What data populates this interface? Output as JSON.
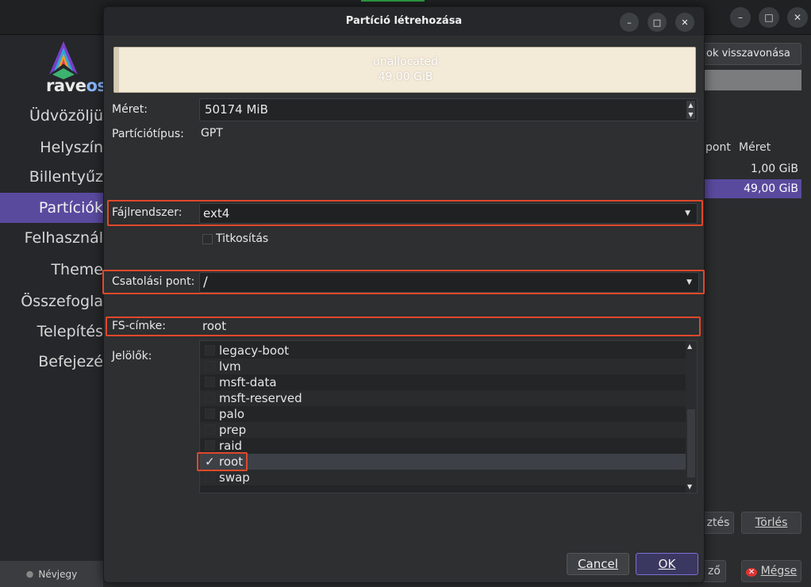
{
  "background": {
    "sidebar": {
      "logo_text_a": "rave",
      "logo_text_b": "os",
      "items": [
        {
          "label": "Üdvözöljü"
        },
        {
          "label": "Helyszín"
        },
        {
          "label": "Billentyűz"
        },
        {
          "label": "Partíciók"
        },
        {
          "label": "Felhasznál"
        },
        {
          "label": "Theme"
        },
        {
          "label": "Összefogla"
        },
        {
          "label": "Telepítés"
        },
        {
          "label": "Befejezé"
        }
      ],
      "about_label": "Névjegy"
    },
    "right": {
      "undo_label": "ok visszavonása",
      "col_mount": "pont",
      "col_size": "Méret",
      "rows": [
        {
          "size": "1,00 GiB"
        },
        {
          "size": "49,00 GiB"
        }
      ],
      "btn_edit": "ztés",
      "btn_delete": "Törlés",
      "btn_next": "ző",
      "btn_cancel": "Mégse"
    },
    "window_buttons": [
      "–",
      "□",
      "✕"
    ]
  },
  "dialog": {
    "title": "Partíció létrehozása",
    "window_buttons": [
      "–",
      "□",
      "✕"
    ],
    "partition_bar": {
      "label": "unallocated",
      "size": "49,00 GiB"
    },
    "size": {
      "label": "Méret:",
      "value": "50174 MiB"
    },
    "partition_type": {
      "label": "Partíciótípus:",
      "value": "GPT"
    },
    "filesystem": {
      "label": "Fájlrendszer:",
      "value": "ext4"
    },
    "encryption": {
      "label": "Titkosítás",
      "checked": false
    },
    "mount_point": {
      "label": "Csatolási pont:",
      "value": "/"
    },
    "fs_label": {
      "label": "FS-címke:",
      "value": "root"
    },
    "flags": {
      "label": "Jelölők:",
      "items": [
        {
          "name": "legacy-boot",
          "checked": false
        },
        {
          "name": "lvm",
          "checked": false
        },
        {
          "name": "msft-data",
          "checked": false
        },
        {
          "name": "msft-reserved",
          "checked": false
        },
        {
          "name": "palo",
          "checked": false
        },
        {
          "name": "prep",
          "checked": false
        },
        {
          "name": "raid",
          "checked": false
        },
        {
          "name": "root",
          "checked": true,
          "mark": "✓"
        },
        {
          "name": "swap",
          "checked": false
        }
      ]
    },
    "buttons": {
      "cancel": "Cancel",
      "ok": "OK"
    }
  },
  "colors": {
    "accent": "#5a4a9e",
    "highlight": "#e0482a",
    "partition_bar": "#f3ead7"
  }
}
